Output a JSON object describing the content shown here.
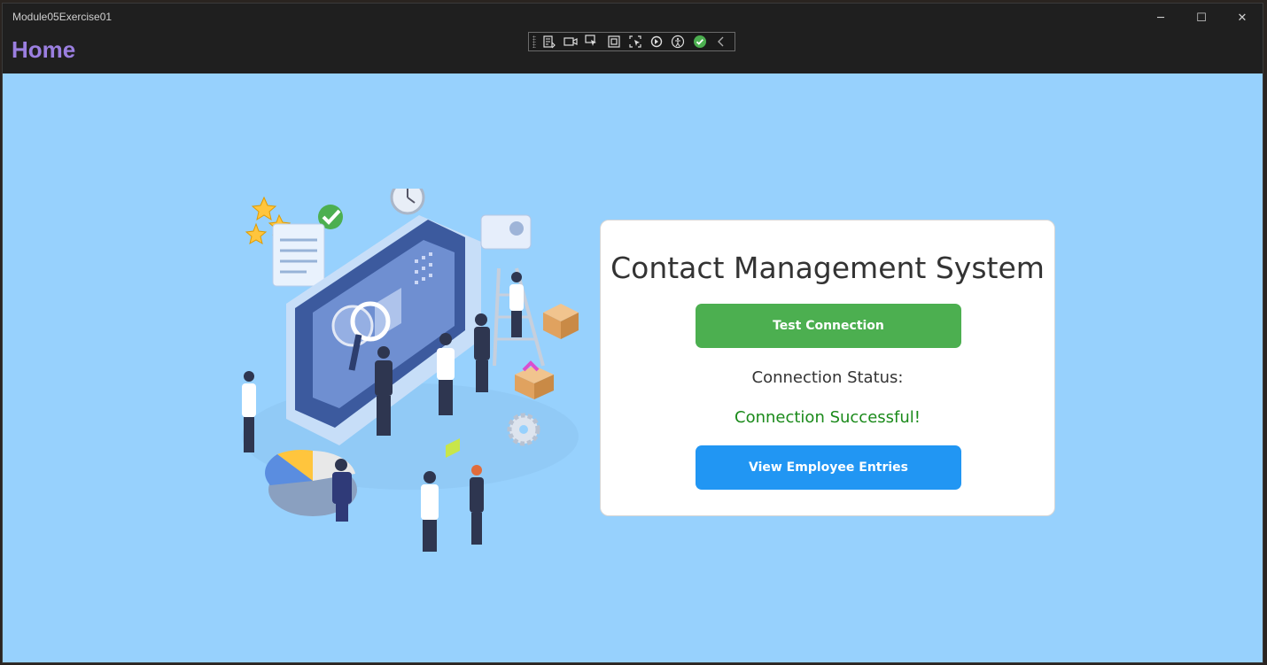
{
  "window": {
    "title": "Module05Exercise01",
    "controls": {
      "minimize": "─",
      "maximize": "☐",
      "close": "✕"
    }
  },
  "page": {
    "title": "Home"
  },
  "debug_toolbar": {
    "icons": [
      "live-visual-tree-icon",
      "record-icon",
      "select-element-icon",
      "display-layout-adorners-icon",
      "track-focus-icon",
      "hot-reload-icon",
      "accessibility-icon",
      "check-icon",
      "collapse-chevron-icon"
    ]
  },
  "card": {
    "title": "Contact Management System",
    "test_button": "Test Connection",
    "status_label": "Connection Status:",
    "status_value": "Connection Successful!",
    "view_button": "View Employee Entries"
  },
  "colors": {
    "content_bg": "#97d1fd",
    "accent_green": "#4caf50",
    "accent_blue": "#2196f3",
    "success_text": "#1a8a1a",
    "header_purple": "#9b7fe0"
  }
}
